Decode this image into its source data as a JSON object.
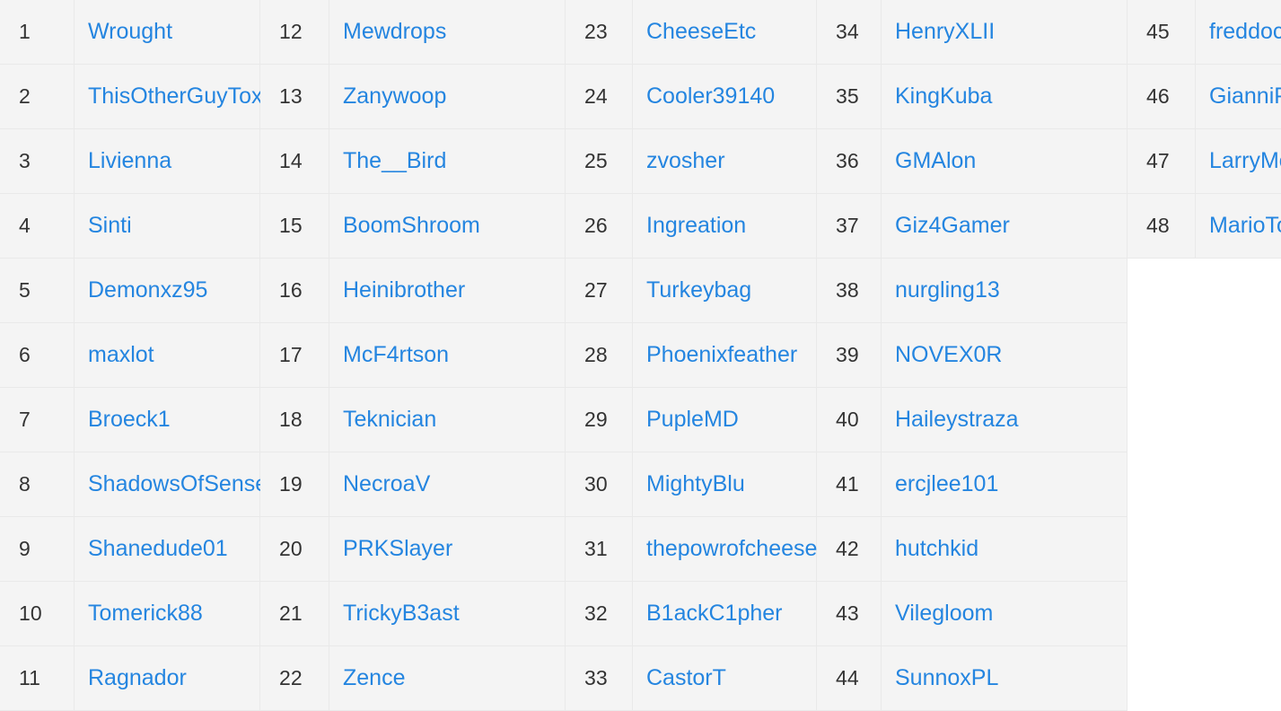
{
  "colors": {
    "link": "#2485e0",
    "rank_text": "#333333",
    "row_bg": "#f4f4f4",
    "border": "#e9e9e9",
    "page_bg": "#ffffff"
  },
  "leaderboard": {
    "columns": [
      {
        "rows": [
          {
            "rank": "1",
            "name": "Wrought"
          },
          {
            "rank": "2",
            "name": "ThisOtherGuyTox"
          },
          {
            "rank": "3",
            "name": "Livienna"
          },
          {
            "rank": "4",
            "name": "Sinti"
          },
          {
            "rank": "5",
            "name": "Demonxz95"
          },
          {
            "rank": "6",
            "name": "maxlot"
          },
          {
            "rank": "7",
            "name": "Broeck1"
          },
          {
            "rank": "8",
            "name": "ShadowsOfSense"
          },
          {
            "rank": "9",
            "name": "Shanedude01"
          },
          {
            "rank": "10",
            "name": "Tomerick88"
          },
          {
            "rank": "11",
            "name": "Ragnador"
          }
        ]
      },
      {
        "rows": [
          {
            "rank": "12",
            "name": "Mewdrops"
          },
          {
            "rank": "13",
            "name": "Zanywoop"
          },
          {
            "rank": "14",
            "name": "The__Bird"
          },
          {
            "rank": "15",
            "name": "BoomShroom"
          },
          {
            "rank": "16",
            "name": "Heinibrother"
          },
          {
            "rank": "17",
            "name": "McF4rtson"
          },
          {
            "rank": "18",
            "name": "Teknician"
          },
          {
            "rank": "19",
            "name": "NecroaV"
          },
          {
            "rank": "20",
            "name": "PRKSlayer"
          },
          {
            "rank": "21",
            "name": "TrickyB3ast"
          },
          {
            "rank": "22",
            "name": "Zence"
          }
        ]
      },
      {
        "rows": [
          {
            "rank": "23",
            "name": "CheeseEtc"
          },
          {
            "rank": "24",
            "name": "Cooler39140"
          },
          {
            "rank": "25",
            "name": "zvosher"
          },
          {
            "rank": "26",
            "name": "Ingreation"
          },
          {
            "rank": "27",
            "name": "Turkeybag"
          },
          {
            "rank": "28",
            "name": "Phoenixfeather"
          },
          {
            "rank": "29",
            "name": "PupleMD"
          },
          {
            "rank": "30",
            "name": "MightyBlu"
          },
          {
            "rank": "31",
            "name": "thepowrofcheese"
          },
          {
            "rank": "32",
            "name": "B1ackC1pher"
          },
          {
            "rank": "33",
            "name": "CastorT"
          }
        ]
      },
      {
        "rows": [
          {
            "rank": "34",
            "name": "HenryXLII"
          },
          {
            "rank": "35",
            "name": "KingKuba"
          },
          {
            "rank": "36",
            "name": "GMAlon"
          },
          {
            "rank": "37",
            "name": "Giz4Gamer"
          },
          {
            "rank": "38",
            "name": "nurgling13"
          },
          {
            "rank": "39",
            "name": "NOVEX0R"
          },
          {
            "rank": "40",
            "name": "Haileystraza"
          },
          {
            "rank": "41",
            "name": "ercjlee101"
          },
          {
            "rank": "42",
            "name": "hutchkid"
          },
          {
            "rank": "43",
            "name": "Vilegloom"
          },
          {
            "rank": "44",
            "name": "SunnoxPL"
          }
        ]
      },
      {
        "rows": [
          {
            "rank": "45",
            "name": "freddoccino"
          },
          {
            "rank": "46",
            "name": "GianniPiccioni"
          },
          {
            "rank": "47",
            "name": "LarryMoments"
          },
          {
            "rank": "48",
            "name": "MarioToast"
          }
        ]
      }
    ]
  }
}
